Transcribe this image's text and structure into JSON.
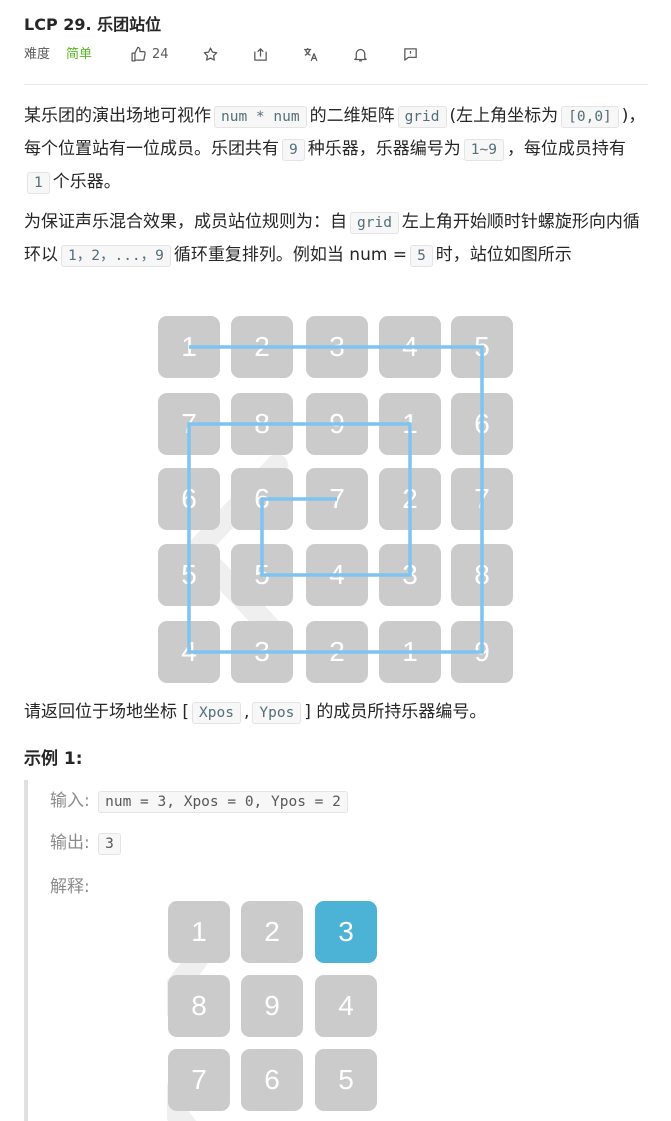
{
  "problem": {
    "title": "LCP 29. 乐团站位",
    "difficulty_label": "难度",
    "difficulty_value": "简单",
    "likes": "24",
    "accent_easy": "#5ab726"
  },
  "icons": [
    "thumb-up-icon",
    "star-icon",
    "share-icon",
    "translate-icon",
    "bell-icon",
    "feedback-icon"
  ],
  "description": {
    "p1": {
      "t1": "某乐团的演出场地可视作",
      "c1": "num * num",
      "t2": "的二维矩阵",
      "c2": "grid",
      "t3": "(左上角坐标为",
      "c3": "[0,0]",
      "t4": ")，每个位置站有一位成员。乐团共有",
      "c4": "9",
      "t5": "种乐器，乐器编号为",
      "c5": "1~9",
      "t6": "，每位成员持有",
      "c6": "1",
      "t7": "个乐器。"
    },
    "p2": {
      "t1": "为保证声乐混合效果，成员站位规则为：自",
      "c1": "grid",
      "t2": "左上角开始顺时针螺旋形向内循环以",
      "c2": "1，2，...，9",
      "t3": "循环重复排列。例如当 num =",
      "c3": "5",
      "t4": "时，站位如图所示"
    },
    "p3": {
      "t1": "请返回位于场地坐标 [",
      "c1": "Xpos",
      "t2": ",",
      "c2": "Ypos",
      "t3": "] 的成员所持乐器编号。"
    }
  },
  "figure1": {
    "cells": [
      [
        "1",
        "2",
        "3",
        "4",
        "5"
      ],
      [
        "7",
        "8",
        "9",
        "1",
        "6"
      ],
      [
        "6",
        "6",
        "7",
        "2",
        "7"
      ],
      [
        "5",
        "5",
        "4",
        "3",
        "8"
      ],
      [
        "4",
        "3",
        "2",
        "1",
        "9"
      ]
    ],
    "cell_color": "#cbcbcb",
    "line_color": "#7fc4f0"
  },
  "example1": {
    "heading": "示例 1:",
    "input_label": "输入:",
    "input_value": "num = 3, Xpos = 0, Ypos = 2",
    "output_label": "输出:",
    "output_value": "3",
    "explain_label": "解释:",
    "cells": [
      [
        "1",
        "2",
        "3"
      ],
      [
        "8",
        "9",
        "4"
      ],
      [
        "7",
        "6",
        "5"
      ]
    ],
    "highlight": [
      0,
      2
    ],
    "highlight_color": "#4cb3d6"
  }
}
